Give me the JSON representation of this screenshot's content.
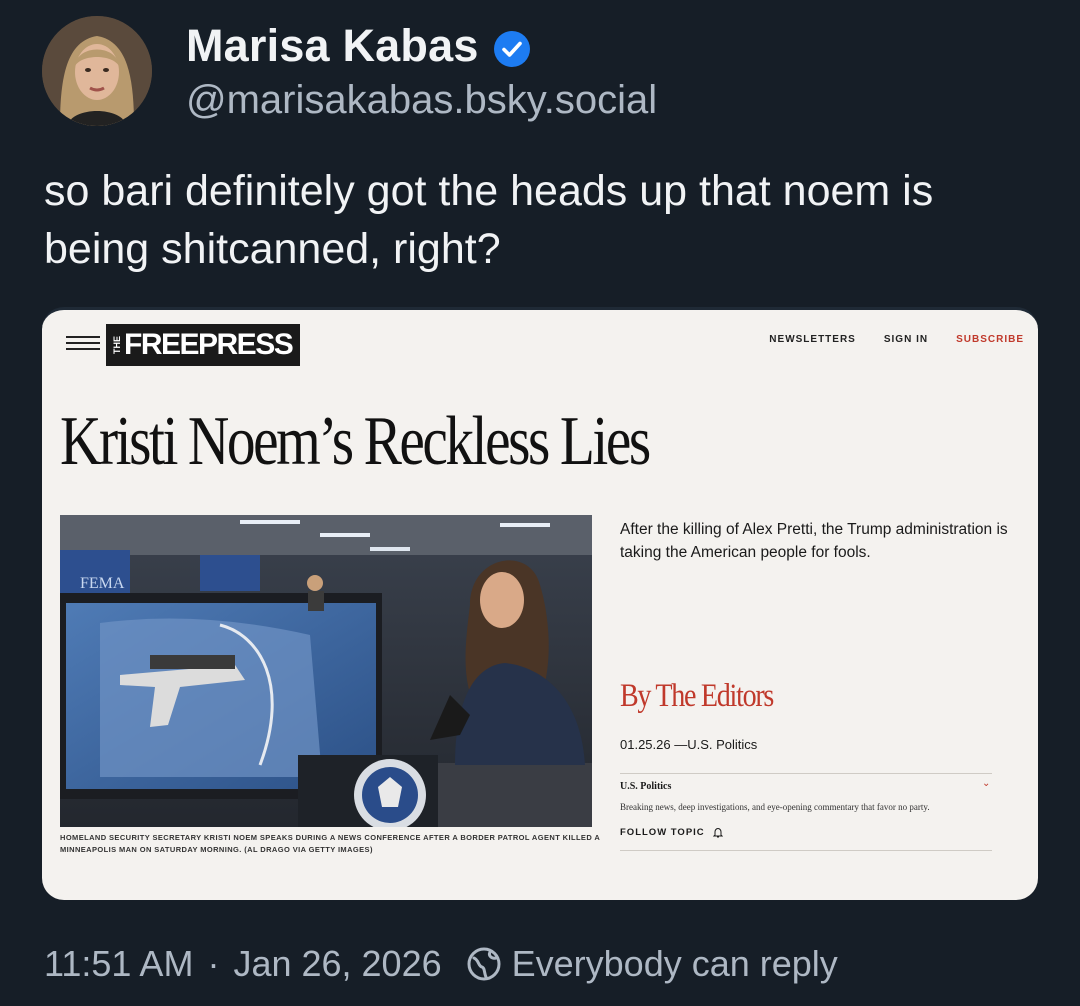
{
  "author": {
    "display_name": "Marisa Kabas",
    "handle": "@marisakabas.bsky.social"
  },
  "post": {
    "text": "so bari definitely got the heads up that noem is being shitcanned, right?"
  },
  "embed": {
    "site": {
      "logo_small": "THE",
      "logo": "FREEPRESS",
      "nav": {
        "newsletters": "NEWSLETTERS",
        "sign_in": "SIGN IN",
        "subscribe": "SUBSCRIBE"
      }
    },
    "headline": "Kristi Noem’s Reckless Lies",
    "photo_caption": "HOMELAND SECURITY SECRETARY KRISTI NOEM SPEAKS DURING A NEWS CONFERENCE AFTER A BORDER PATROL AGENT KILLED A MINNEAPOLIS MAN ON SATURDAY MORNING. (AL DRAGO VIA GETTY IMAGES)",
    "dek": "After the killing of Alex Pretti, the Trump administration is taking the American people for fools.",
    "byline": "By The Editors",
    "dateline": "01.25.26 —U.S. Politics",
    "topic": {
      "name": "U.S. Politics",
      "description": "Breaking news, deep investigations, and eye-opening commentary that favor no party.",
      "follow_label": "FOLLOW TOPIC"
    },
    "photo_text": {
      "fema": "FEMA"
    }
  },
  "meta": {
    "time": "11:51 AM",
    "separator": "·",
    "date": "Jan 26, 2026",
    "reply_setting": "Everybody can reply"
  },
  "colors": {
    "background": "#161e27",
    "verified": "#1d7cf2",
    "accent_red": "#c0392b"
  }
}
